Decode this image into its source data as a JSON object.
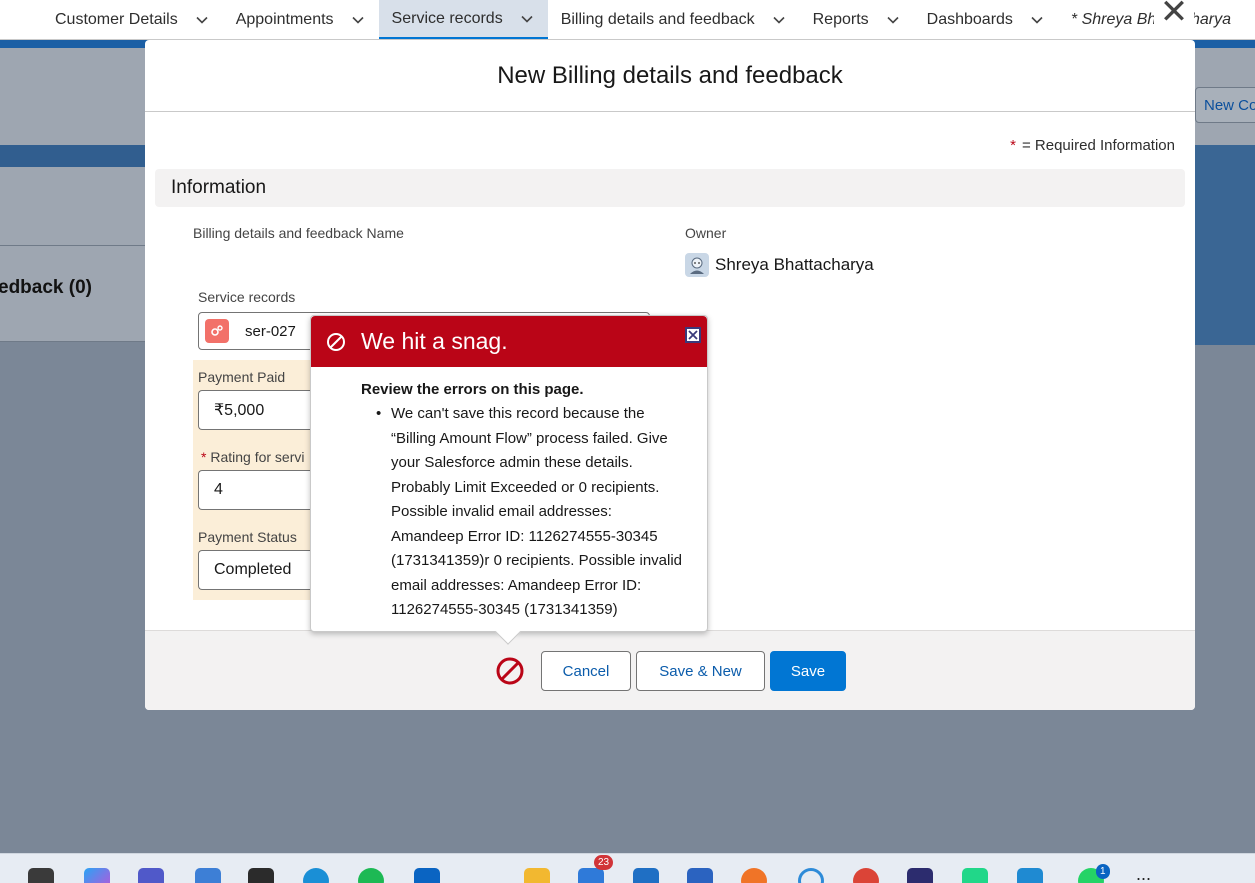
{
  "nav": {
    "items": [
      {
        "label": "Customer Details"
      },
      {
        "label": "Appointments"
      },
      {
        "label": "Service records"
      },
      {
        "label": "Billing details and feedback"
      },
      {
        "label": "Reports"
      },
      {
        "label": "Dashboards"
      },
      {
        "label": "* Shreya Bhattacharya"
      }
    ],
    "active_item": "Service records"
  },
  "background": {
    "related_list_title": "edback (0)",
    "new_button_label": "New Co"
  },
  "modal": {
    "title": "New Billing details and feedback",
    "required_star": "*",
    "required_info": "= Required Information",
    "section_title": "Information",
    "fields": {
      "name_label": "Billing details and feedback Name",
      "owner_label": "Owner",
      "owner_value": "Shreya Bhattacharya",
      "service_records_label": "Service records",
      "service_records_value": "ser-027",
      "payment_paid_label": "Payment Paid",
      "payment_paid_value": "₹5,000",
      "rating_star": "*",
      "rating_label": "Rating for servi",
      "rating_value": "4",
      "payment_status_label": "Payment Status",
      "payment_status_value": "Completed"
    },
    "footer": {
      "cancel_label": "Cancel",
      "save_new_label": "Save & New",
      "save_label": "Save"
    }
  },
  "error_popover": {
    "title": "We hit a snag.",
    "heading": "Review the errors on this page.",
    "messages": [
      "We can't save this record because the “Billing Amount Flow” process failed. Give your Salesforce admin these details. Probably Limit Exceeded or 0 recipients. Possible invalid email addresses: Amandeep Error ID: 1126274555-30345 (1731341359)r 0 recipients. Possible invalid email addresses: Amandeep Error ID: 1126274555-30345 (1731341359)"
    ]
  },
  "taskbar": {
    "badges": {
      "mail": "23",
      "whatsapp": "1"
    },
    "overflow": "..."
  },
  "colors": {
    "error_red": "#ba0517",
    "brand_blue": "#0176d3",
    "overlay": "#7b8797"
  }
}
